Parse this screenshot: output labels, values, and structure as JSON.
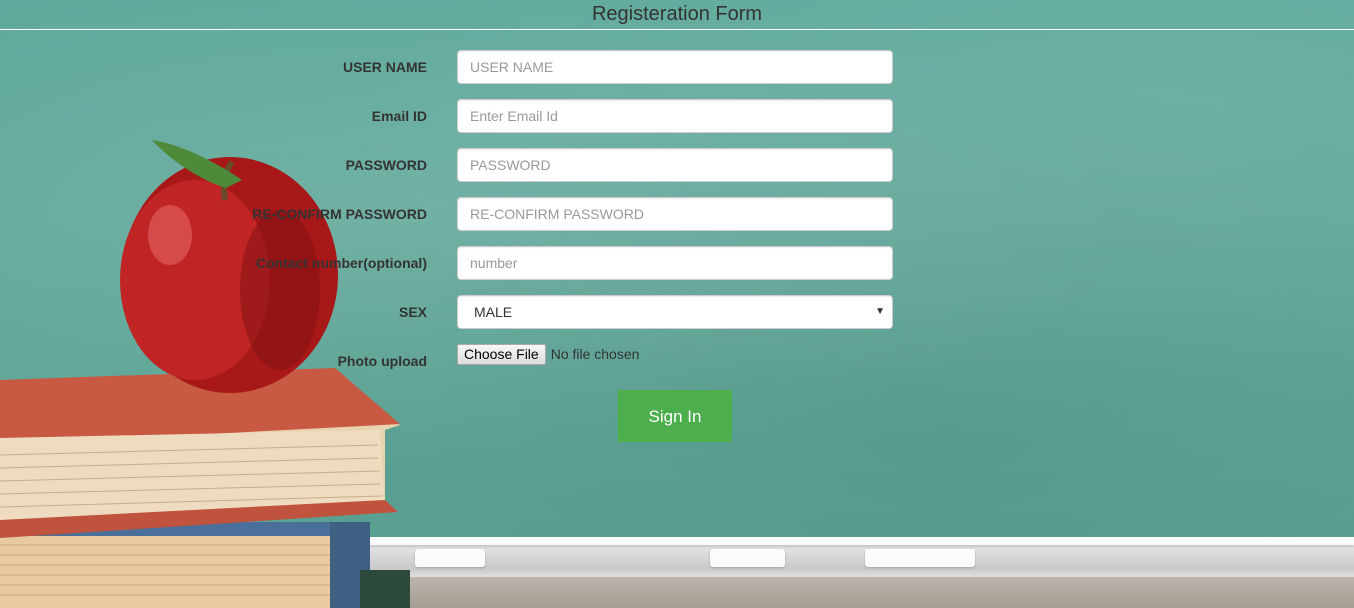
{
  "header": {
    "title": "Registeration Form"
  },
  "form": {
    "username": {
      "label": "USER NAME",
      "placeholder": "USER NAME"
    },
    "email": {
      "label": "Email ID",
      "placeholder": "Enter Email Id"
    },
    "password": {
      "label": "PASSWORD",
      "placeholder": "PASSWORD"
    },
    "reconfirm": {
      "label": "RE-CONFIRM PASSWORD",
      "placeholder": "RE-CONFIRM PASSWORD"
    },
    "contact": {
      "label": "Contact number(optional)",
      "placeholder": "number"
    },
    "sex": {
      "label": "SEX",
      "selected": "MALE"
    },
    "photo": {
      "label": "Photo upload",
      "button": "Choose File",
      "status": "No file chosen"
    },
    "submit_label": "Sign In"
  },
  "colors": {
    "board": "#5faa9c",
    "submit": "#4cae4c",
    "apple": "#b01c1c"
  }
}
